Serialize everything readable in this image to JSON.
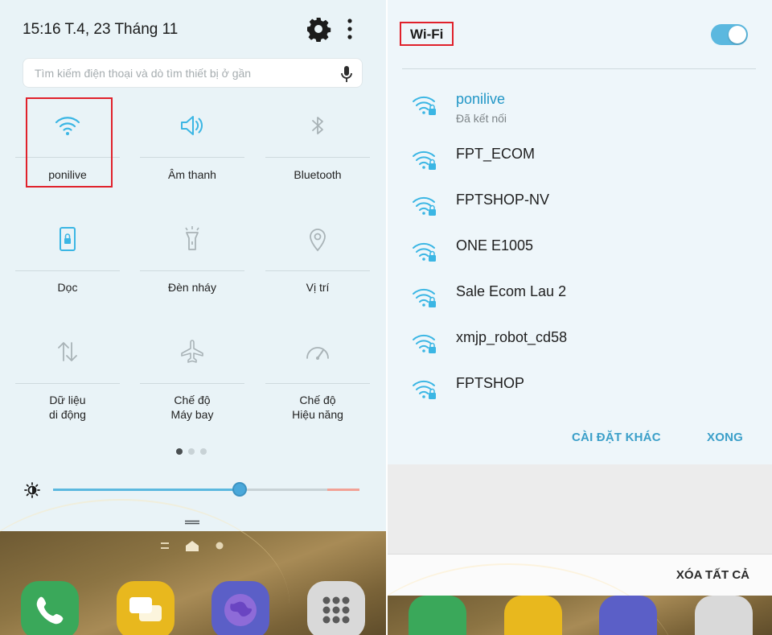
{
  "status": {
    "time_date": "15:16  T.4, 23 Tháng 11"
  },
  "search": {
    "placeholder": "Tìm kiếm điện thoại và dò tìm thiết bị ở gần"
  },
  "tiles": [
    {
      "label": "ponilive",
      "icon": "wifi-icon",
      "active": true
    },
    {
      "label": "Âm thanh",
      "icon": "speaker-icon",
      "active": true
    },
    {
      "label": "Bluetooth",
      "icon": "bluetooth-icon",
      "active": false
    },
    {
      "label": "Dọc",
      "icon": "portrait-lock-icon",
      "active": true
    },
    {
      "label": "Đèn nháy",
      "icon": "flashlight-icon",
      "active": false
    },
    {
      "label": "Vị trí",
      "icon": "location-icon",
      "active": false
    },
    {
      "label": "Dữ liệu\ndi động",
      "icon": "mobile-data-icon",
      "active": false
    },
    {
      "label": "Chế độ\nMáy bay",
      "icon": "airplane-icon",
      "active": false
    },
    {
      "label": "Chế độ\nHiệu năng",
      "icon": "performance-icon",
      "active": false
    }
  ],
  "pager": {
    "pages": 3,
    "current": 1
  },
  "brightness": {
    "level": 0.61
  },
  "colors": {
    "accent": "#2196c6",
    "active_icon": "#3bb6e4",
    "inactive_icon": "#a9b3b7",
    "highlight": "#e0212b"
  },
  "wifi_dialog": {
    "title": "Wi-Fi",
    "enabled": true,
    "networks": [
      {
        "name": "ponilive",
        "status": "Đã kết nối",
        "connected": true
      },
      {
        "name": "FPT_ECOM",
        "status": "",
        "connected": false
      },
      {
        "name": "FPTSHOP-NV",
        "status": "",
        "connected": false
      },
      {
        "name": "ONE E1005",
        "status": "",
        "connected": false
      },
      {
        "name": "Sale Ecom Lau 2",
        "status": "",
        "connected": false
      },
      {
        "name": "xmjp_robot_cd58",
        "status": "",
        "connected": false
      },
      {
        "name": "FPTSHOP",
        "status": "",
        "connected": false
      }
    ],
    "more_settings_label": "CÀI ĐẶT KHÁC",
    "done_label": "XONG"
  },
  "notifications": {
    "clear_all_label": "XÓA TẤT CẢ"
  }
}
